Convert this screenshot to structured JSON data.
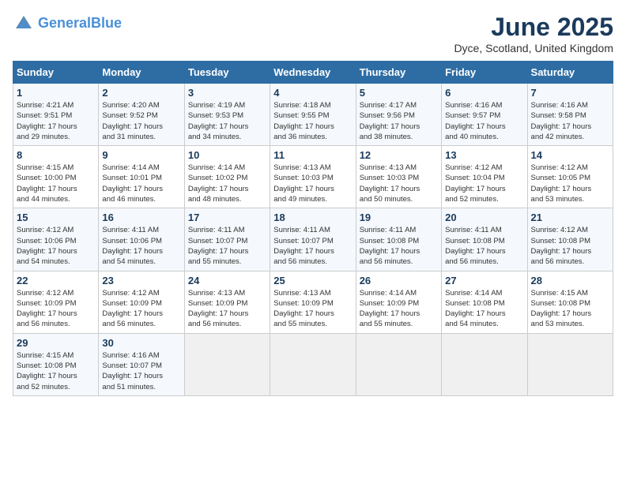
{
  "logo": {
    "line1": "General",
    "line2": "Blue"
  },
  "title": "June 2025",
  "subtitle": "Dyce, Scotland, United Kingdom",
  "days_of_week": [
    "Sunday",
    "Monday",
    "Tuesday",
    "Wednesday",
    "Thursday",
    "Friday",
    "Saturday"
  ],
  "weeks": [
    [
      {
        "day": "1",
        "info": "Sunrise: 4:21 AM\nSunset: 9:51 PM\nDaylight: 17 hours\nand 29 minutes."
      },
      {
        "day": "2",
        "info": "Sunrise: 4:20 AM\nSunset: 9:52 PM\nDaylight: 17 hours\nand 31 minutes."
      },
      {
        "day": "3",
        "info": "Sunrise: 4:19 AM\nSunset: 9:53 PM\nDaylight: 17 hours\nand 34 minutes."
      },
      {
        "day": "4",
        "info": "Sunrise: 4:18 AM\nSunset: 9:55 PM\nDaylight: 17 hours\nand 36 minutes."
      },
      {
        "day": "5",
        "info": "Sunrise: 4:17 AM\nSunset: 9:56 PM\nDaylight: 17 hours\nand 38 minutes."
      },
      {
        "day": "6",
        "info": "Sunrise: 4:16 AM\nSunset: 9:57 PM\nDaylight: 17 hours\nand 40 minutes."
      },
      {
        "day": "7",
        "info": "Sunrise: 4:16 AM\nSunset: 9:58 PM\nDaylight: 17 hours\nand 42 minutes."
      }
    ],
    [
      {
        "day": "8",
        "info": "Sunrise: 4:15 AM\nSunset: 10:00 PM\nDaylight: 17 hours\nand 44 minutes."
      },
      {
        "day": "9",
        "info": "Sunrise: 4:14 AM\nSunset: 10:01 PM\nDaylight: 17 hours\nand 46 minutes."
      },
      {
        "day": "10",
        "info": "Sunrise: 4:14 AM\nSunset: 10:02 PM\nDaylight: 17 hours\nand 48 minutes."
      },
      {
        "day": "11",
        "info": "Sunrise: 4:13 AM\nSunset: 10:03 PM\nDaylight: 17 hours\nand 49 minutes."
      },
      {
        "day": "12",
        "info": "Sunrise: 4:13 AM\nSunset: 10:03 PM\nDaylight: 17 hours\nand 50 minutes."
      },
      {
        "day": "13",
        "info": "Sunrise: 4:12 AM\nSunset: 10:04 PM\nDaylight: 17 hours\nand 52 minutes."
      },
      {
        "day": "14",
        "info": "Sunrise: 4:12 AM\nSunset: 10:05 PM\nDaylight: 17 hours\nand 53 minutes."
      }
    ],
    [
      {
        "day": "15",
        "info": "Sunrise: 4:12 AM\nSunset: 10:06 PM\nDaylight: 17 hours\nand 54 minutes."
      },
      {
        "day": "16",
        "info": "Sunrise: 4:11 AM\nSunset: 10:06 PM\nDaylight: 17 hours\nand 54 minutes."
      },
      {
        "day": "17",
        "info": "Sunrise: 4:11 AM\nSunset: 10:07 PM\nDaylight: 17 hours\nand 55 minutes."
      },
      {
        "day": "18",
        "info": "Sunrise: 4:11 AM\nSunset: 10:07 PM\nDaylight: 17 hours\nand 56 minutes."
      },
      {
        "day": "19",
        "info": "Sunrise: 4:11 AM\nSunset: 10:08 PM\nDaylight: 17 hours\nand 56 minutes."
      },
      {
        "day": "20",
        "info": "Sunrise: 4:11 AM\nSunset: 10:08 PM\nDaylight: 17 hours\nand 56 minutes."
      },
      {
        "day": "21",
        "info": "Sunrise: 4:12 AM\nSunset: 10:08 PM\nDaylight: 17 hours\nand 56 minutes."
      }
    ],
    [
      {
        "day": "22",
        "info": "Sunrise: 4:12 AM\nSunset: 10:09 PM\nDaylight: 17 hours\nand 56 minutes."
      },
      {
        "day": "23",
        "info": "Sunrise: 4:12 AM\nSunset: 10:09 PM\nDaylight: 17 hours\nand 56 minutes."
      },
      {
        "day": "24",
        "info": "Sunrise: 4:13 AM\nSunset: 10:09 PM\nDaylight: 17 hours\nand 56 minutes."
      },
      {
        "day": "25",
        "info": "Sunrise: 4:13 AM\nSunset: 10:09 PM\nDaylight: 17 hours\nand 55 minutes."
      },
      {
        "day": "26",
        "info": "Sunrise: 4:14 AM\nSunset: 10:09 PM\nDaylight: 17 hours\nand 55 minutes."
      },
      {
        "day": "27",
        "info": "Sunrise: 4:14 AM\nSunset: 10:08 PM\nDaylight: 17 hours\nand 54 minutes."
      },
      {
        "day": "28",
        "info": "Sunrise: 4:15 AM\nSunset: 10:08 PM\nDaylight: 17 hours\nand 53 minutes."
      }
    ],
    [
      {
        "day": "29",
        "info": "Sunrise: 4:15 AM\nSunset: 10:08 PM\nDaylight: 17 hours\nand 52 minutes."
      },
      {
        "day": "30",
        "info": "Sunrise: 4:16 AM\nSunset: 10:07 PM\nDaylight: 17 hours\nand 51 minutes."
      },
      {
        "day": "",
        "info": ""
      },
      {
        "day": "",
        "info": ""
      },
      {
        "day": "",
        "info": ""
      },
      {
        "day": "",
        "info": ""
      },
      {
        "day": "",
        "info": ""
      }
    ]
  ]
}
